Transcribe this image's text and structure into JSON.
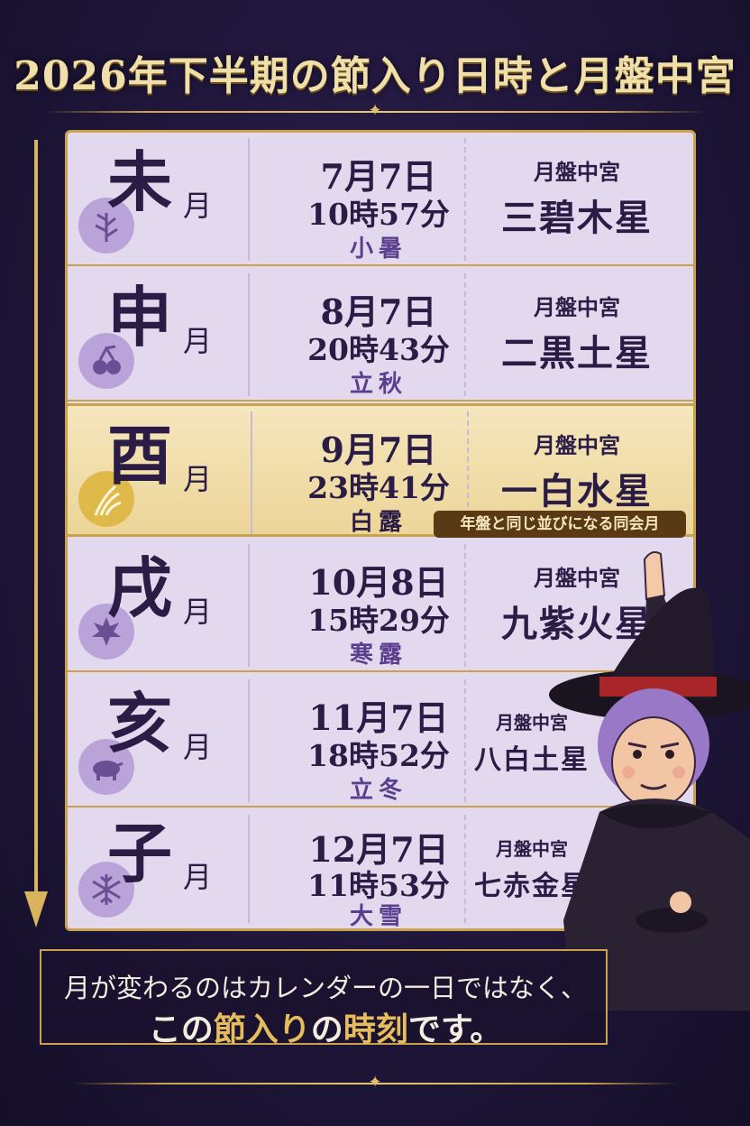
{
  "title": "2026年下半期の節入り日時と月盤中宮",
  "ornament": "✦",
  "rows": [
    {
      "kanji": "未",
      "suffix": "月",
      "date": "7月7日",
      "time": "10時57分",
      "term": "小暑",
      "star_label": "月盤中宮",
      "star": "三碧木星",
      "icon": "herb-icon"
    },
    {
      "kanji": "申",
      "suffix": "月",
      "date": "8月7日",
      "time": "20時43分",
      "term": "立秋",
      "star_label": "月盤中宮",
      "star": "二黒土星",
      "icon": "fruit-icon"
    },
    {
      "kanji": "酉",
      "suffix": "月",
      "date": "9月7日",
      "time": "23時41分",
      "term": "白露",
      "star_label": "月盤中宮",
      "star": "一白水星",
      "icon": "rice-icon",
      "note": "年盤と同じ並びになる同会月"
    },
    {
      "kanji": "戌",
      "suffix": "月",
      "date": "10月8日",
      "time": "15時29分",
      "term": "寒露",
      "star_label": "月盤中宮",
      "star": "九紫火星",
      "icon": "maple-leaf-icon"
    },
    {
      "kanji": "亥",
      "suffix": "月",
      "date": "11月7日",
      "time": "18時52分",
      "term": "立冬",
      "star_label": "月盤中宮",
      "star": "八白土星",
      "icon": "boar-icon"
    },
    {
      "kanji": "子",
      "suffix": "月",
      "date": "12月7日",
      "time": "11時53分",
      "term": "大雪",
      "star_label": "月盤中宮",
      "star": "七赤金星",
      "icon": "snowflake-icon"
    }
  ],
  "footer": {
    "line1": "月が変わるのはカレンダーの一日ではなく、",
    "line2_a": "この",
    "line2_b": "節入り",
    "line2_c": "の",
    "line2_d": "時刻",
    "line2_e": "です。"
  },
  "colors": {
    "gold": "#c9a24c",
    "bg": "#1e1538",
    "row": "#e3d9ef",
    "highlight": "#f0dca8",
    "ink": "#2b1c46"
  }
}
